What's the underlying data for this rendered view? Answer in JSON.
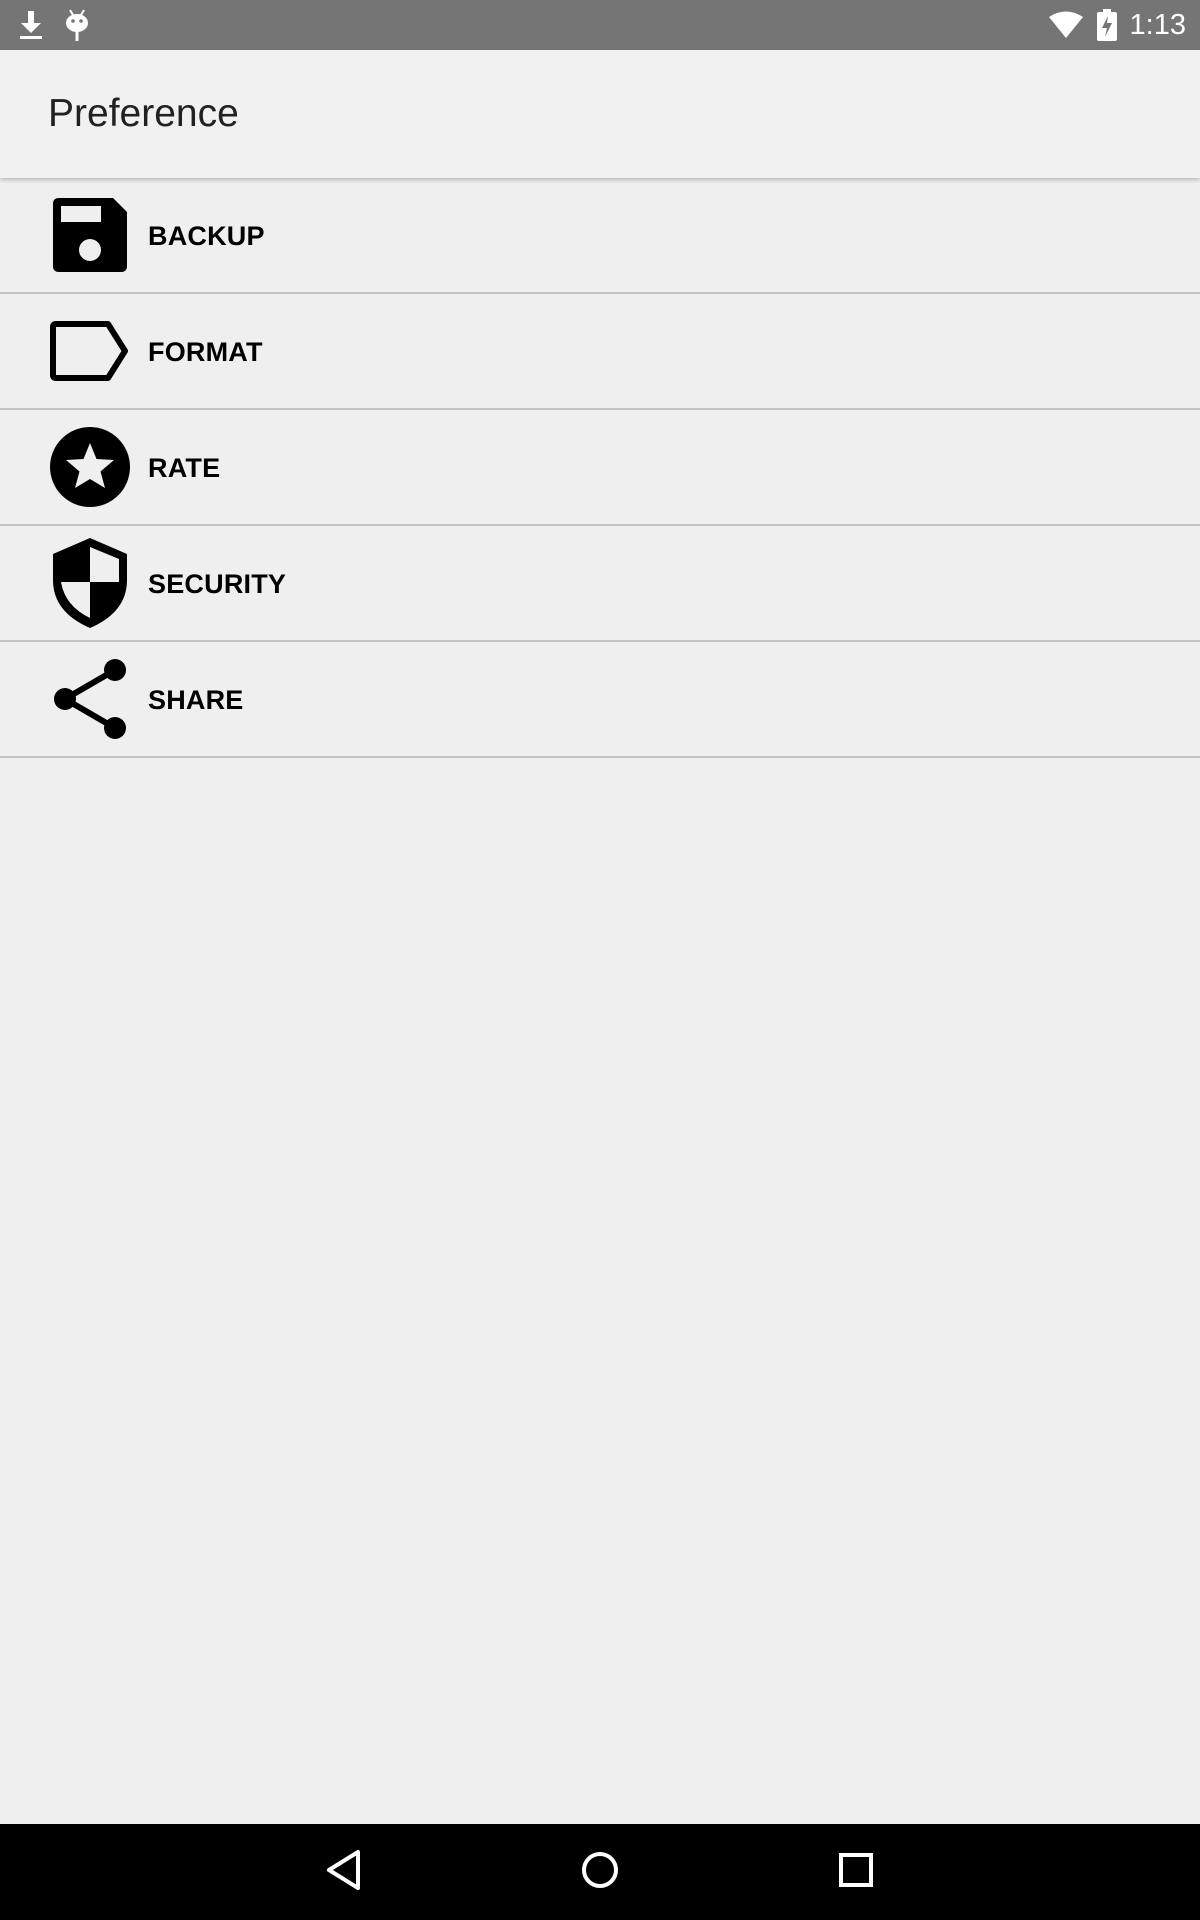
{
  "status_bar": {
    "time": "1:13",
    "left_icons": [
      "download-icon",
      "android-icon"
    ],
    "right_icons": [
      "wifi-icon",
      "battery-charging-icon"
    ]
  },
  "app_bar": {
    "title": "Preference"
  },
  "preferences": [
    {
      "label": "BACKUP",
      "icon": "floppy-disk-icon"
    },
    {
      "label": "FORMAT",
      "icon": "label-tag-icon"
    },
    {
      "label": "RATE",
      "icon": "star-circle-icon"
    },
    {
      "label": "SECURITY",
      "icon": "shield-icon"
    },
    {
      "label": "SHARE",
      "icon": "share-icon"
    }
  ],
  "nav_bar": {
    "buttons": [
      "back-icon",
      "home-icon",
      "recents-icon"
    ]
  },
  "colors": {
    "status_bar": "#757575",
    "background": "#efefef",
    "app_bar": "#f1f1f1",
    "divider": "#c4c4c4",
    "nav_bar": "#000000"
  }
}
